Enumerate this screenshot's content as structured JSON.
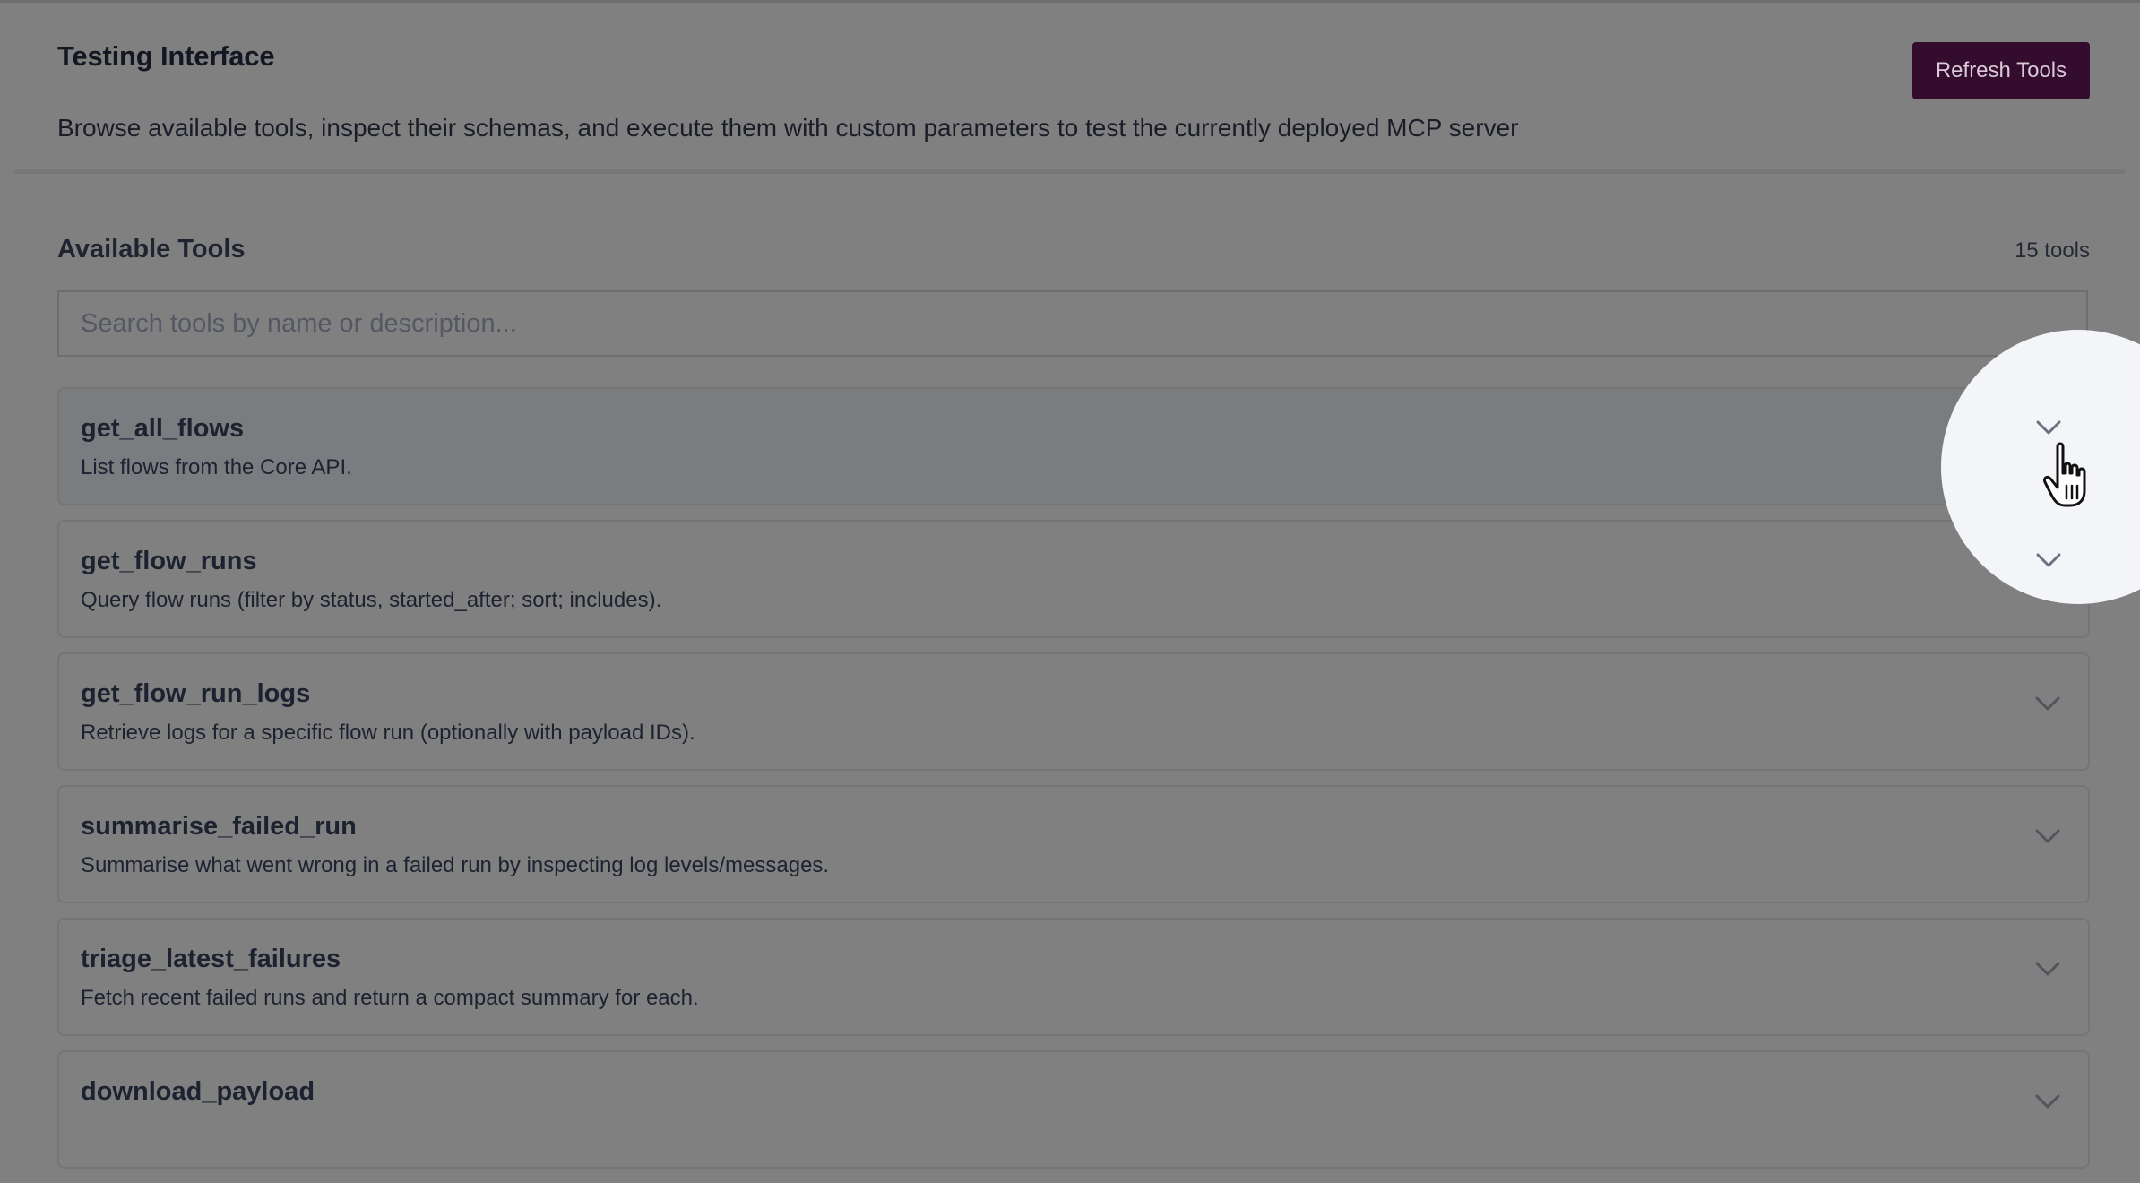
{
  "header": {
    "title": "Testing Interface",
    "subtitle": "Browse available tools, inspect their schemas, and execute them with custom parameters to test the currently deployed MCP server",
    "refresh_label": "Refresh Tools",
    "accent_color": "#330c2e"
  },
  "tools_section": {
    "title": "Available Tools",
    "count_label": "15 tools",
    "search_placeholder": "Search tools by name or description...",
    "search_value": ""
  },
  "tools": [
    {
      "name": "get_all_flows",
      "description": "List flows from the Core API.",
      "icon": "chevron-down-icon"
    },
    {
      "name": "get_flow_runs",
      "description": "Query flow runs (filter by status, started_after; sort; includes).",
      "icon": "chevron-down-icon"
    },
    {
      "name": "get_flow_run_logs",
      "description": "Retrieve logs for a specific flow run (optionally with payload IDs).",
      "icon": "chevron-down-icon"
    },
    {
      "name": "summarise_failed_run",
      "description": "Summarise what went wrong in a failed run by inspecting log levels/messages.",
      "icon": "chevron-down-icon"
    },
    {
      "name": "triage_latest_failures",
      "description": "Fetch recent failed runs and return a compact summary for each.",
      "icon": "chevron-down-icon"
    },
    {
      "name": "download_payload",
      "description": "",
      "icon": "chevron-down-icon"
    }
  ],
  "cursor": {
    "icon": "hand-pointer-icon"
  }
}
